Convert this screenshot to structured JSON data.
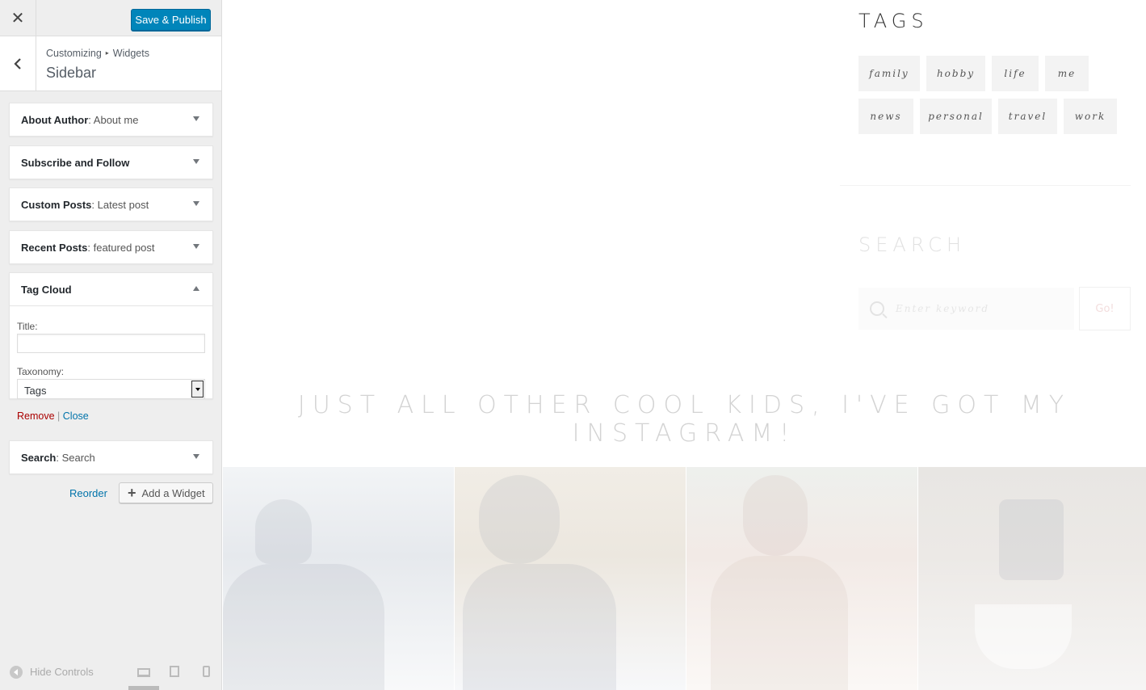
{
  "customizer": {
    "close_icon": "close-icon",
    "publish_label": "Save & Publish",
    "breadcrumb": {
      "root": "Customizing",
      "separator": "▸",
      "current": "Widgets"
    },
    "section_title": "Sidebar",
    "widgets": [
      {
        "name": "About Author",
        "title": ": About me",
        "expanded": false
      },
      {
        "name": "Subscribe and Follow",
        "title": "",
        "expanded": false
      },
      {
        "name": "Custom Posts",
        "title": ": Latest post",
        "expanded": false
      },
      {
        "name": "Recent Posts",
        "title": ": featured post",
        "expanded": false
      },
      {
        "name": "Tag Cloud",
        "title": "",
        "expanded": true
      },
      {
        "name": "Search",
        "title": ": Search",
        "expanded": false
      }
    ],
    "tag_cloud_form": {
      "title_label": "Title:",
      "title_value": "",
      "taxonomy_label": "Taxonomy:",
      "taxonomy_value": "Tags",
      "remove_label": "Remove",
      "separator": "|",
      "close_label": "Close"
    },
    "reorder_label": "Reorder",
    "add_widget_label": "Add a Widget",
    "hide_controls_label": "Hide Controls"
  },
  "preview": {
    "tags_title": "TAGS",
    "tags": [
      "family",
      "hobby",
      "life",
      "me",
      "news",
      "personal",
      "travel",
      "work"
    ],
    "search_title": "SEARCH",
    "search_placeholder": "Enter keyword",
    "search_button": "Go!",
    "instagram_heading": "JUST ALL OTHER COOL KIDS, I'VE GOT MY INSTAGRAM!"
  },
  "colors": {
    "accent": "#0085ba",
    "link": "#0073aa",
    "remove": "#aa0000"
  }
}
